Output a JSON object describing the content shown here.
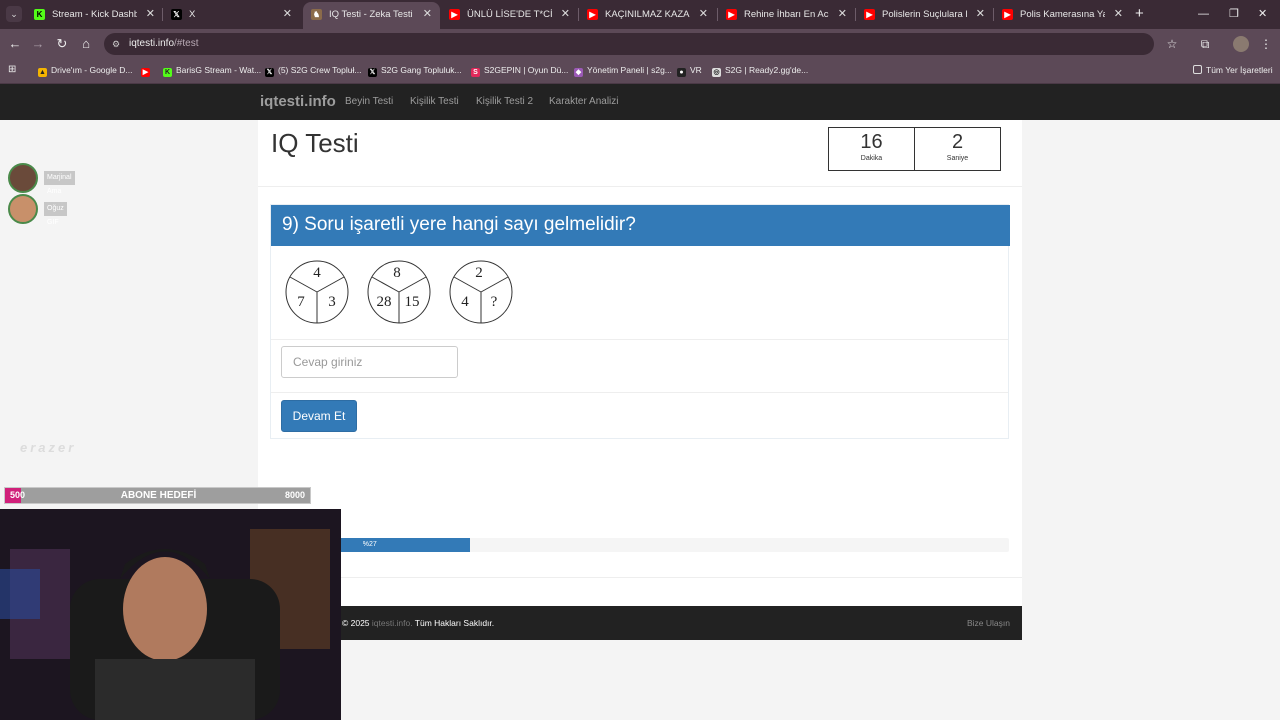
{
  "browser": {
    "tabs": [
      {
        "label": "Stream - Kick Dashboard",
        "favicon": "kick-icon",
        "color": "#53fc18",
        "glyph": "K"
      },
      {
        "label": "X",
        "favicon": "x-icon",
        "color": "#000000",
        "glyph": "𝕏"
      },
      {
        "label": "IQ Testi - Zeka Testi",
        "favicon": "iqtesti-icon",
        "color": "#8b6b4a",
        "glyph": "♞",
        "active": true
      },
      {
        "label": "ÜNLÜ LİSE'DE T*CİZ İDDİA",
        "favicon": "youtube-icon",
        "color": "#ff0000",
        "glyph": "▶"
      },
      {
        "label": "KAÇINILMAZ KAZA! Türki",
        "favicon": "youtube-icon",
        "color": "#ff0000",
        "glyph": "▶"
      },
      {
        "label": "Rehine İhbarı En Acı Polis",
        "favicon": "youtube-icon",
        "color": "#ff0000",
        "glyph": "▶"
      },
      {
        "label": "Polislerin Suçlulara Karşı",
        "favicon": "youtube-icon",
        "color": "#ff0000",
        "glyph": "▶"
      },
      {
        "label": "Polis Kamerasına Yakalan",
        "favicon": "youtube-icon",
        "color": "#ff0000",
        "glyph": "▶"
      }
    ],
    "url_host": "iqtesti.info",
    "url_path": "/#test",
    "bookmarks": [
      {
        "label": "Drive'ım - Google D...",
        "icon": "google-drive-icon",
        "color": "#f4b400",
        "glyph": "▲"
      },
      {
        "label": "",
        "icon": "youtube-icon",
        "color": "#ff0000",
        "glyph": "▶"
      },
      {
        "label": "BarisG Stream - Wat...",
        "icon": "kick-icon",
        "color": "#53fc18",
        "glyph": "K"
      },
      {
        "label": "(5) S2G Crew Topluł...",
        "icon": "x-icon",
        "color": "#000000",
        "glyph": "𝕏"
      },
      {
        "label": "S2G Gang Topluluk...",
        "icon": "x-icon",
        "color": "#000000",
        "glyph": "𝕏"
      },
      {
        "label": "S2GEPIN | Oyun Dü...",
        "icon": "s2gepin-icon",
        "color": "#e0285a",
        "glyph": "S"
      },
      {
        "label": "Yönetim Paneli | s2g...",
        "icon": "panel-icon",
        "color": "#9b59b6",
        "glyph": "◆"
      },
      {
        "label": "VR",
        "icon": "vr-icon",
        "color": "#222222",
        "glyph": "●"
      },
      {
        "label": "S2G | Ready2.gg'de...",
        "icon": "ready2-icon",
        "color": "#dddddd",
        "glyph": "◎"
      }
    ],
    "all_bookmarks": "Tüm Yer İşaretleri"
  },
  "site": {
    "brand": "iqtesti.info",
    "nav": [
      "Beyin Testi",
      "Kişilik Testi",
      "Kişilik Testi 2",
      "Karakter Analizi"
    ]
  },
  "test": {
    "title": "IQ Testi",
    "timer_minutes": "16",
    "timer_minutes_label": "Dakika",
    "timer_seconds": "2",
    "timer_seconds_label": "Saniye",
    "question": "9) Soru işaretli yere hangi sayı gelmelidir?",
    "circles": [
      {
        "top": "4",
        "left": "7",
        "right": "3"
      },
      {
        "top": "8",
        "left": "28",
        "right": "15"
      },
      {
        "top": "2",
        "left": "4",
        "right": "?"
      }
    ],
    "answer_placeholder": "Cevap giriniz",
    "continue_label": "Devam Et",
    "progress_percent": 27,
    "progress_label": "%27"
  },
  "footer": {
    "copyright_prefix": "© 2025",
    "copyright_site": "iqtesti.info.",
    "copyright_suffix": "Tüm Hakları Saklıdır.",
    "contact": "Bize Ulaşın"
  },
  "overlay": {
    "viewers": [
      "Marjinal Ama KAJA",
      "Oğuz GIF"
    ],
    "watermark": "erazer",
    "sub_goal_label": "ABONE HEDEFİ",
    "sub_goal_current": "500",
    "sub_goal_target": "8000"
  },
  "colors": {
    "primary": "#337ab7",
    "navbar": "#222222",
    "browser_frame": "#5c4957"
  }
}
